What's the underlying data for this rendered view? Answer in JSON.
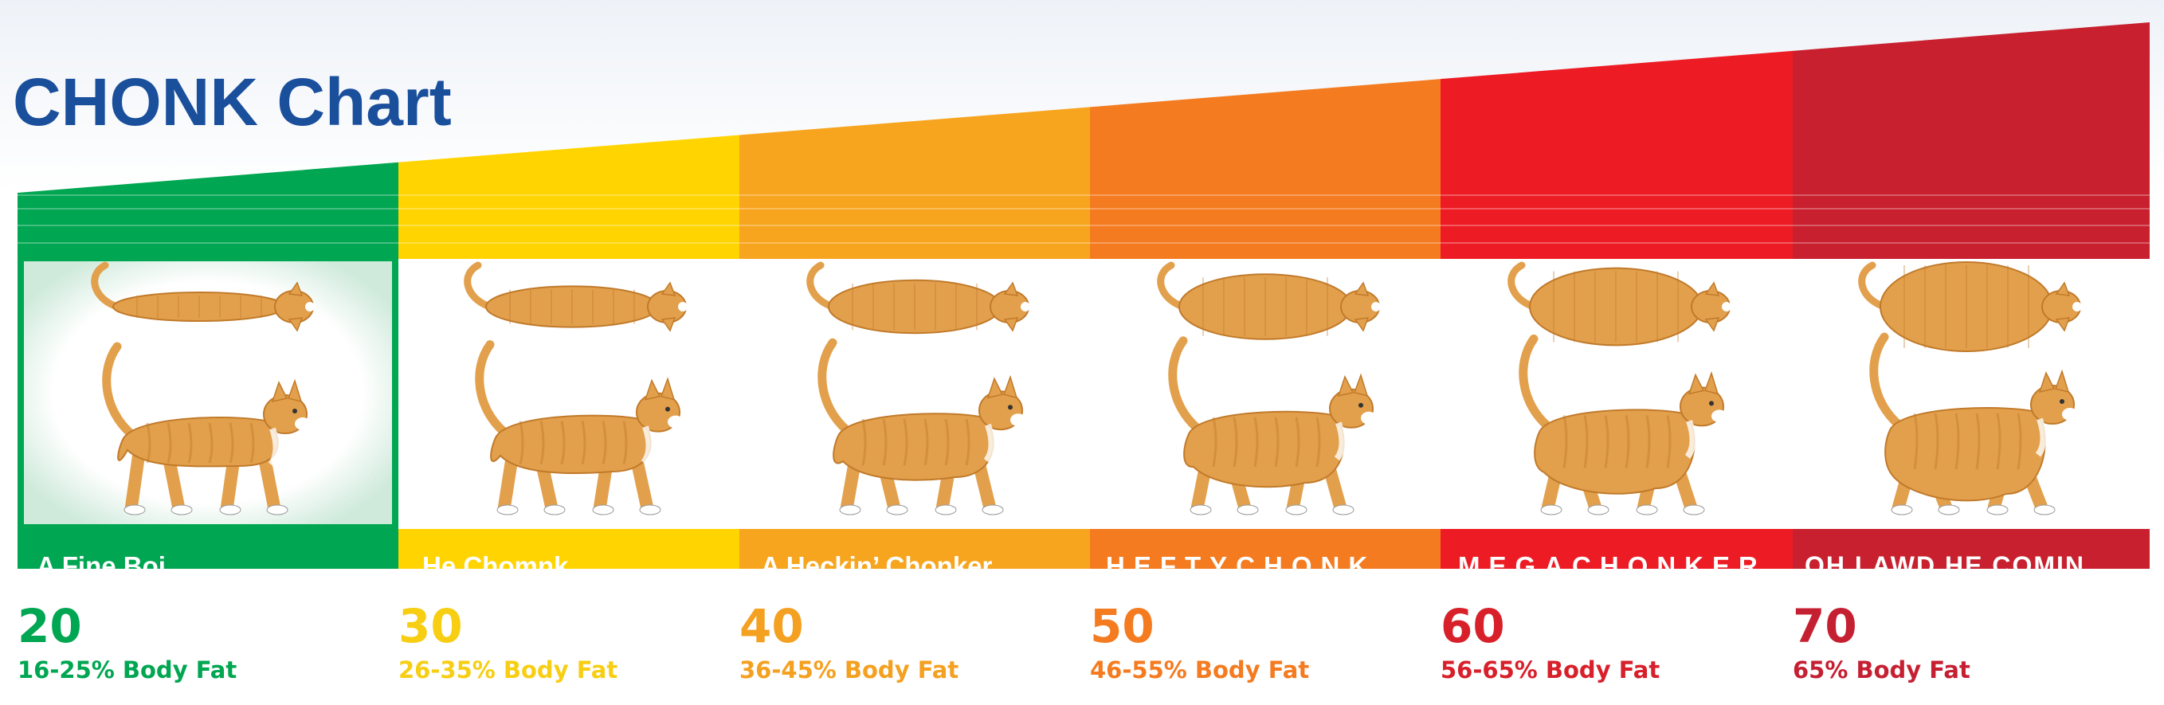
{
  "title": "CHONK Chart",
  "categories": [
    {
      "label": "A Fine Boi",
      "value": "20",
      "body_fat": "16-25% Body Fat",
      "color": "#00a651",
      "text_color": "#00a651",
      "fatness": 0.0
    },
    {
      "label": "He Chomnk",
      "value": "30",
      "body_fat": "26-35% Body Fat",
      "color": "#ffd400",
      "text_color": "#f7ce12",
      "fatness": 0.2
    },
    {
      "label": "A Heckin’ Chonker",
      "value": "40",
      "body_fat": "36-45% Body Fat",
      "color": "#f7a51e",
      "text_color": "#f4a020",
      "fatness": 0.4
    },
    {
      "label": "HEFTYCHONK",
      "value": "50",
      "body_fat": "46-55% Body Fat",
      "color": "#f47b20",
      "text_color": "#f47b20",
      "fatness": 0.6
    },
    {
      "label": "MEGACHONKER",
      "value": "60",
      "body_fat": "56-65% Body Fat",
      "color": "#ed1c24",
      "text_color": "#d8202a",
      "fatness": 0.8
    },
    {
      "label": "OH LAWD HE COMIN",
      "value": "70",
      "body_fat": "65% Body Fat",
      "color": "#c8202e",
      "text_color": "#c52032",
      "fatness": 1.0
    }
  ],
  "colors": {
    "title": "#1a4f9c",
    "cat_fur": "#e2a04c",
    "cat_stripe": "#c17a2a"
  }
}
